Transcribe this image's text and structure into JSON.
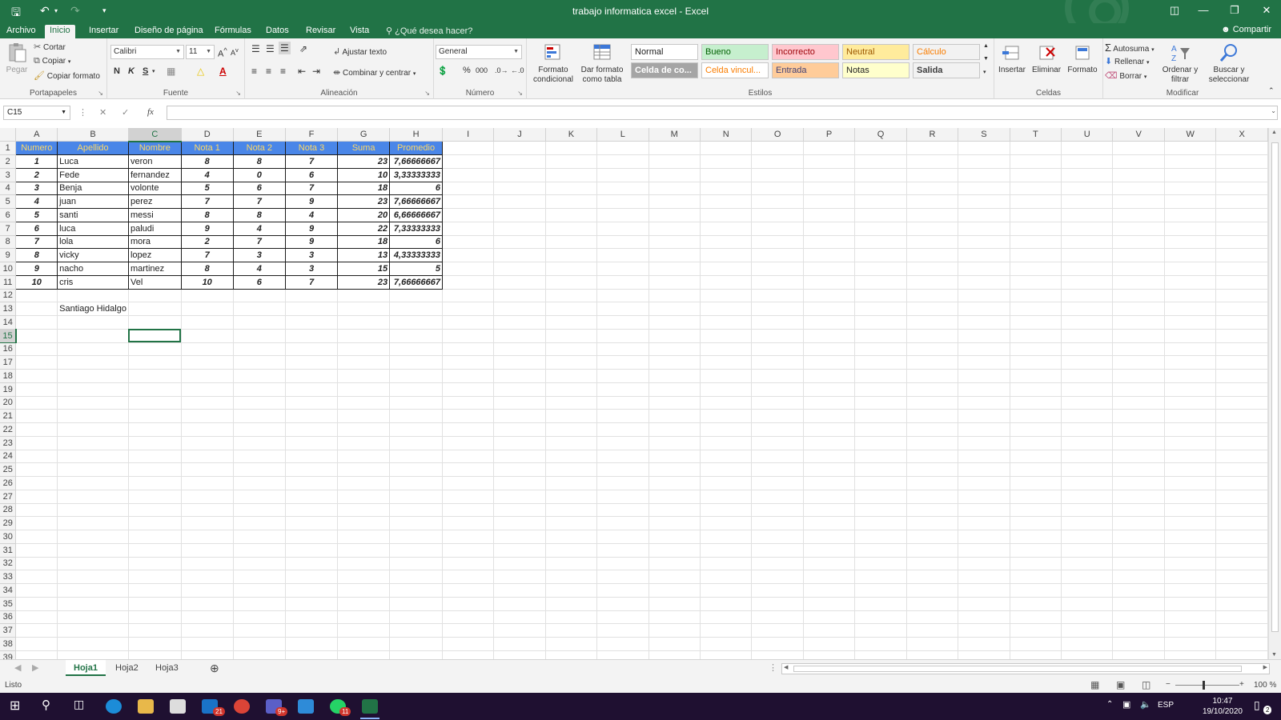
{
  "window": {
    "title": "trabajo informatica excel - Excel"
  },
  "ribbon_tabs": [
    "Archivo",
    "Inicio",
    "Insertar",
    "Diseño de página",
    "Fórmulas",
    "Datos",
    "Revisar",
    "Vista"
  ],
  "tell_me": "¿Qué desea hacer?",
  "share": "Compartir",
  "clipboard": {
    "paste": "Pegar",
    "cut": "Cortar",
    "copy": "Copiar",
    "format_painter": "Copiar formato",
    "label": "Portapapeles"
  },
  "font": {
    "name": "Calibri",
    "size": "11",
    "bold": "N",
    "italic": "K",
    "underline": "S",
    "label": "Fuente"
  },
  "alignment": {
    "wrap": "Ajustar texto",
    "merge": "Combinar y centrar",
    "label": "Alineación"
  },
  "number": {
    "format": "General",
    "label": "Número"
  },
  "styles": {
    "cond_format": "Formato condicional",
    "as_table": "Dar formato como tabla",
    "cells": [
      {
        "label": "Normal",
        "bg": "#ffffff",
        "color": "#222222"
      },
      {
        "label": "Bueno",
        "bg": "#c6efce",
        "color": "#006100"
      },
      {
        "label": "Incorrecto",
        "bg": "#ffc7ce",
        "color": "#9c0006"
      },
      {
        "label": "Neutral",
        "bg": "#ffeb9c",
        "color": "#9c5700"
      },
      {
        "label": "Cálculo",
        "bg": "#f2f2f2",
        "color": "#fa7d00"
      },
      {
        "label": "Celda de co...",
        "bg": "#a5a5a5",
        "color": "#ffffff"
      },
      {
        "label": "Celda vincul...",
        "bg": "#ffffff",
        "color": "#fa7d00"
      },
      {
        "label": "Entrada",
        "bg": "#ffcc99",
        "color": "#3f3f76"
      },
      {
        "label": "Notas",
        "bg": "#ffffcc",
        "color": "#222222"
      },
      {
        "label": "Salida",
        "bg": "#f2f2f2",
        "color": "#3f3f3f"
      }
    ],
    "label": "Estilos"
  },
  "cells_group": {
    "insert": "Insertar",
    "delete": "Eliminar",
    "format": "Formato",
    "label": "Celdas"
  },
  "editing": {
    "autosum": "Autosuma",
    "fill": "Rellenar",
    "clear": "Borrar",
    "sort": "Ordenar y filtrar",
    "find": "Buscar y seleccionar",
    "label": "Modificar"
  },
  "formula_bar": {
    "name_box": "C15",
    "fx": "fx",
    "content": ""
  },
  "columns": [
    "A",
    "B",
    "C",
    "D",
    "E",
    "F",
    "G",
    "H",
    "I",
    "J",
    "K",
    "L",
    "M",
    "N",
    "O",
    "P",
    "Q",
    "R",
    "S",
    "T",
    "U",
    "V",
    "W",
    "X"
  ],
  "selected_cell": {
    "col": "C",
    "row": 15
  },
  "table": {
    "headers": [
      "Numero",
      "Apellido",
      "Nombre",
      "Nota 1",
      "Nota 2",
      "Nota 3",
      "Suma",
      "Promedio"
    ],
    "rows": [
      [
        "1",
        "Luca",
        "veron",
        "8",
        "8",
        "7",
        "23",
        "7,66666667"
      ],
      [
        "2",
        "Fede",
        "fernandez",
        "4",
        "0",
        "6",
        "10",
        "3,33333333"
      ],
      [
        "3",
        "Benja",
        "volonte",
        "5",
        "6",
        "7",
        "18",
        "6"
      ],
      [
        "4",
        "juan",
        "perez",
        "7",
        "7",
        "9",
        "23",
        "7,66666667"
      ],
      [
        "5",
        "santi",
        "messi",
        "8",
        "8",
        "4",
        "20",
        "6,66666667"
      ],
      [
        "6",
        "luca",
        "paludi",
        "9",
        "4",
        "9",
        "22",
        "7,33333333"
      ],
      [
        "7",
        "lola",
        "mora",
        "2",
        "7",
        "9",
        "18",
        "6"
      ],
      [
        "8",
        "vicky",
        "lopez",
        "7",
        "3",
        "3",
        "13",
        "4,33333333"
      ],
      [
        "9",
        "nacho",
        "martinez",
        "8",
        "4",
        "3",
        "15",
        "5"
      ],
      [
        "10",
        "cris",
        "Vel",
        "10",
        "6",
        "7",
        "23",
        "7,66666667"
      ]
    ],
    "author_cell": "Santiago Hidalgo"
  },
  "sheet_tabs": [
    "Hoja1",
    "Hoja2",
    "Hoja3"
  ],
  "status": {
    "ready": "Listo",
    "zoom": "100 %"
  },
  "taskbar": {
    "lang": "ESP",
    "time": "10:47",
    "date": "19/10/2020",
    "badges": {
      "mail": "21",
      "teams": "9+",
      "whatsapp": "11",
      "notifications": "2"
    }
  },
  "colors": {
    "excel_green": "#217346",
    "header_fill": "#4a86e8",
    "header_text": "#ffd966",
    "taskbar": "#1f1031"
  }
}
